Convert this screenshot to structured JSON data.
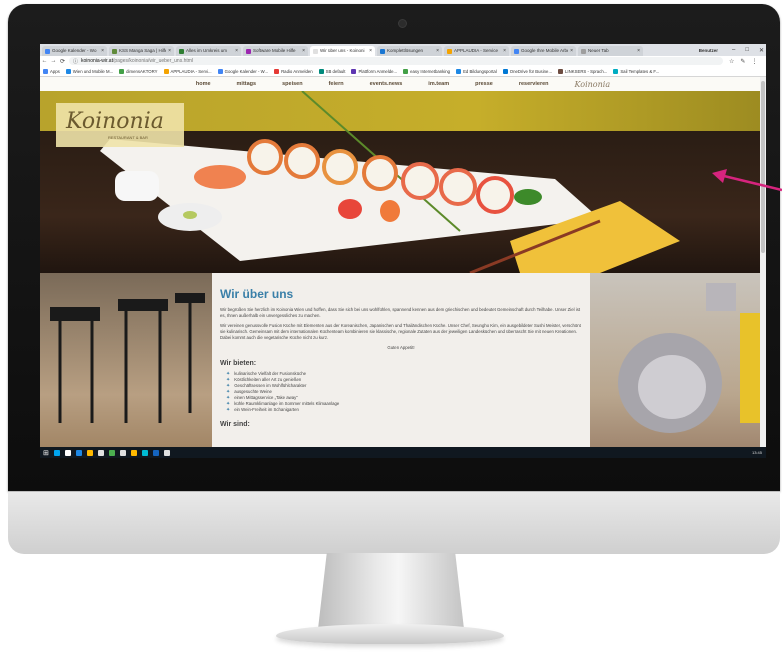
{
  "browser": {
    "tabs": [
      {
        "label": "Google Kalender - Wo",
        "color": "#4285f4",
        "active": false
      },
      {
        "label": "KSS Manga Saga | Hilfe",
        "color": "#5f8a3a",
        "active": false
      },
      {
        "label": "Alles im Umkreis um",
        "color": "#2e7d32",
        "active": false
      },
      {
        "label": "Software Mobile Hilfe",
        "color": "#9c27b0",
        "active": false
      },
      {
        "label": "Wir über uns - Koinoni",
        "color": "#e0e0e0",
        "active": true
      },
      {
        "label": "Komplettlösungen",
        "color": "#1976d2",
        "active": false
      },
      {
        "label": "APPLAUDIA - Service",
        "color": "#f4a300",
        "active": false
      },
      {
        "label": "Google Ihre Mobile Arbeit",
        "color": "#4285f4",
        "active": false
      },
      {
        "label": "Neuer Tab",
        "color": "#9e9e9e",
        "active": false
      }
    ],
    "profile": "Benutzer",
    "url_host": "koinonia-wir.at",
    "url_path": "/pages/koinonia/wir_ueber_uns.html",
    "bookmarks": [
      {
        "label": "Apps",
        "color": "#4285f4"
      },
      {
        "label": "Wien und Mobile M...",
        "color": "#1e88e5"
      },
      {
        "label": "dimensAKTORY",
        "color": "#43a047"
      },
      {
        "label": "APPLAUDIA - Servi...",
        "color": "#f4a300"
      },
      {
        "label": "Google Kalender - W...",
        "color": "#4285f4"
      },
      {
        "label": "Radio Anmelden",
        "color": "#e53935"
      },
      {
        "label": "SB default",
        "color": "#00897b"
      },
      {
        "label": "Plattform Anmelde...",
        "color": "#5e35b1"
      },
      {
        "label": "easy Internetbanking",
        "color": "#43a047"
      },
      {
        "label": "Ed Bildungsportal",
        "color": "#1e88e5"
      },
      {
        "label": "OneDrive für Busine...",
        "color": "#0078d4"
      },
      {
        "label": "LINKSERS - Sprach...",
        "color": "#6d4c41"
      },
      {
        "label": "Sail Templates & F...",
        "color": "#00acc1"
      }
    ]
  },
  "site": {
    "nav": [
      "home",
      "mittags",
      "speisen",
      "feiern",
      "events.news",
      "im.team",
      "presse",
      "reservieren"
    ],
    "nav_logo": "Koinonia",
    "logo": "Koinonia",
    "logo_sub": "RESTAURANT & BAR",
    "content": {
      "title": "Wir über uns",
      "para1": "Wir begrüßen Sie herzlich im Koinonia Wien und hoffen, dass Sie sich bei uns wohlfühlen, spannend kennen aus dem griechischen und bedeutet Gemeinschaft durch Teilhabe. Unser Ziel ist es, Ihnen außerhalb ein unvergessliches zu machen.",
      "para2": "Wir vereinen genussvolle Fusion Küche mit Elementen aus der Koreanischen, Japanischen und Thailändischen Küche. Unser Chef, Seungho Kim, ein ausgebildeter Sushi Meister, verschönt sie kulinarisch. Gemeinsam mit dem internationalen Küchenteam kombinieren sie klassische, regionale Zutaten aus der jeweiligen Landesküchen und überrascht Sie mit neuen Kreationen. Dabei kommt auch die vegetarische Küche nicht zu kurz.",
      "sign": "Guten Appetit!",
      "offer_title": "Wir bieten:",
      "offers": [
        "kulinarische Vielfalt der Fusionsküche",
        "Köstlichkeiten aller Art zu genießen",
        "Geschäftsessen im Wohlfühlcharakter",
        "ausgesuchte Weine",
        "einen Mittagsservice „Take away“",
        "kühle Raumklimanlage im Sommer mittels Klimaanlage",
        "ein Wein-Freiheit im Schanigarten"
      ],
      "next_title": "Wir sind:"
    }
  },
  "taskbar": {
    "clock": "13:45",
    "icons": [
      "#00a4ef",
      "#ffffff",
      "#1e88e5",
      "#ffb900",
      "#e0e0e0",
      "#4caf50",
      "#e0e0e0",
      "#ffb900",
      "#00bcd4",
      "#1565c0",
      "#e0e0e0"
    ]
  },
  "annotation": {
    "color": "#d6247e"
  }
}
